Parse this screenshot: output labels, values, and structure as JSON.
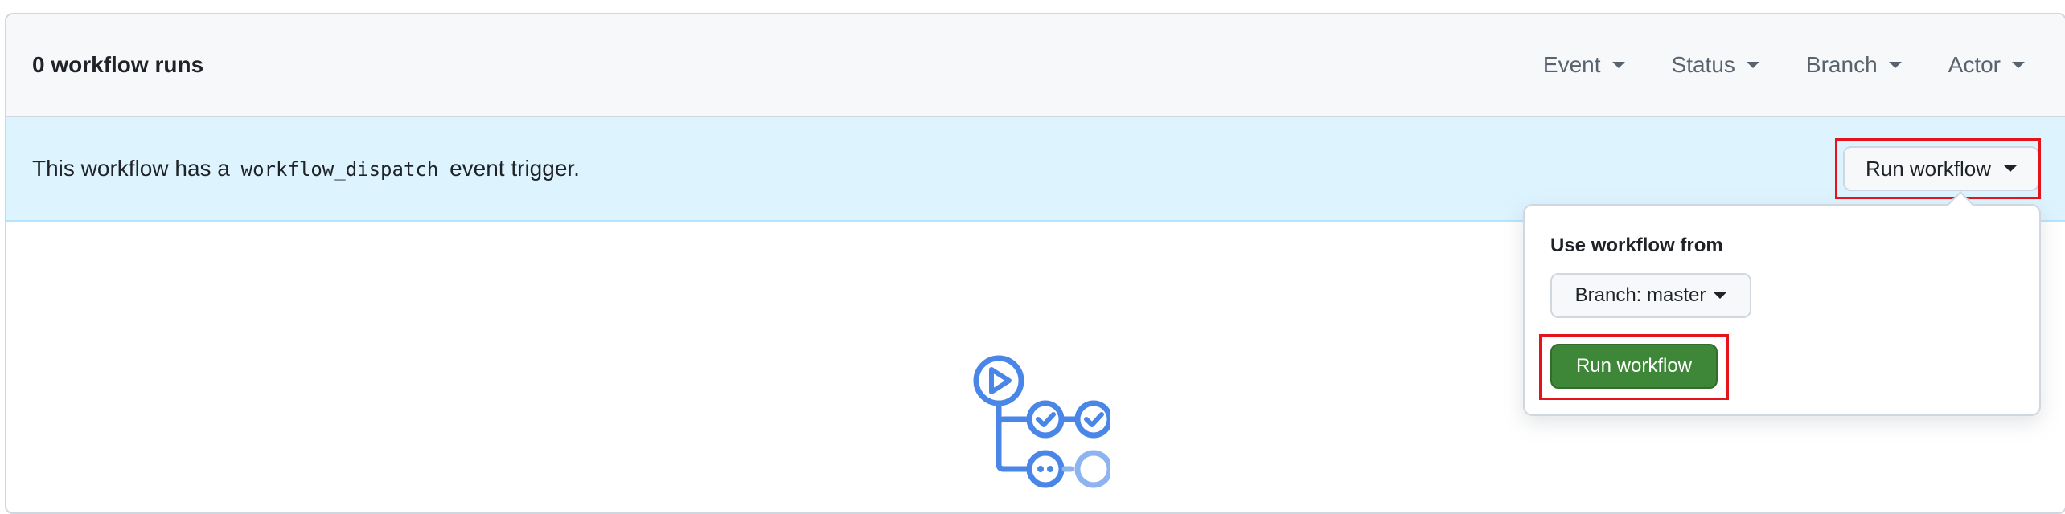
{
  "header": {
    "runs_count": "0 workflow runs",
    "filters": [
      {
        "label": "Event"
      },
      {
        "label": "Status"
      },
      {
        "label": "Branch"
      },
      {
        "label": "Actor"
      }
    ]
  },
  "notice": {
    "text_prefix": "This workflow has a",
    "trigger_code": "workflow_dispatch",
    "text_suffix": "event trigger.",
    "run_button_label": "Run workflow"
  },
  "dropdown": {
    "label": "Use workflow from",
    "branch_button_label": "Branch: master",
    "run_button_label": "Run workflow"
  },
  "colors": {
    "notice_background": "#ddf4ff",
    "primary_green": "#3f8738",
    "highlight_red": "#e5141a",
    "logo_blue": "#4a86e8"
  },
  "icons": {
    "empty_state": "github-actions-workflow-icon"
  }
}
